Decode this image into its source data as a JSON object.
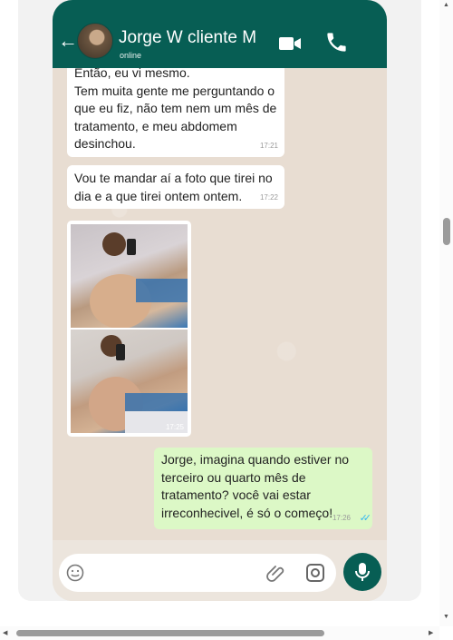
{
  "header": {
    "contact_name": "Jorge W cliente M",
    "status": "online",
    "back_glyph": "←",
    "icons": [
      "back-arrow-icon",
      "video-call-icon",
      "voice-call-icon"
    ]
  },
  "messages": [
    {
      "direction": "incoming",
      "lines": [
        "Então, eu vi mesmo.",
        "Tem muita gente me perguntando o",
        "que eu fiz, não tem nem um mês de",
        "tratamento,  e meu abdomem",
        "desinchou."
      ],
      "time": "17:21"
    },
    {
      "direction": "incoming",
      "lines": [
        "Vou te mandar aí a foto que tirei no",
        "dia e a que tirei ontem ontem."
      ],
      "time": "17:22"
    },
    {
      "direction": "incoming",
      "type": "photo",
      "time": "17:25"
    },
    {
      "direction": "outgoing",
      "lines": [
        "Jorge, imagina quando estiver no",
        "terceiro ou quarto mês de",
        "tratamento? você vai estar",
        "irreconhecivel, é só o começo!"
      ],
      "time": "17:26",
      "read_ticks": "✓✓"
    }
  ],
  "composer": {
    "icons": [
      "emoji-icon",
      "attach-clip-icon",
      "camera-icon",
      "microphone-icon"
    ]
  },
  "colors": {
    "header": "#075e54",
    "outgoing_bubble": "#dcf8c6",
    "incoming_bubble": "#ffffff",
    "read_ticks": "#34b7f1"
  },
  "scrollbars": {
    "up_arrow": "▲",
    "down_arrow": "▼",
    "left_arrow": "◀",
    "right_arrow": "▶"
  }
}
